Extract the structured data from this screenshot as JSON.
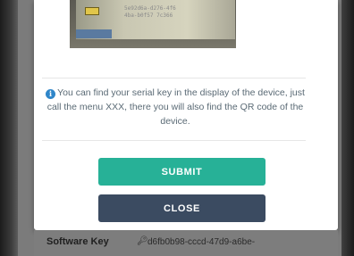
{
  "scan": {
    "text_lines": [
      "5e92d6a-d276-4f6",
      "4ba-b0f57 7c366"
    ]
  },
  "info": {
    "icon": "info-circle-icon",
    "text": "You can find your serial key in the display of the device, just call the menu XXX, there you will also find the QR code of the device."
  },
  "buttons": {
    "submit": "SUBMIT",
    "close": "CLOSE"
  },
  "background": {
    "software_key_label": "Software Key",
    "software_key_icon": "key-icon",
    "software_key_value": "d6fb0b98-cccd-47d9-a6be-"
  },
  "colors": {
    "submit": "#27b197",
    "close": "#3b4b61",
    "info_icon": "#2f86c9"
  }
}
